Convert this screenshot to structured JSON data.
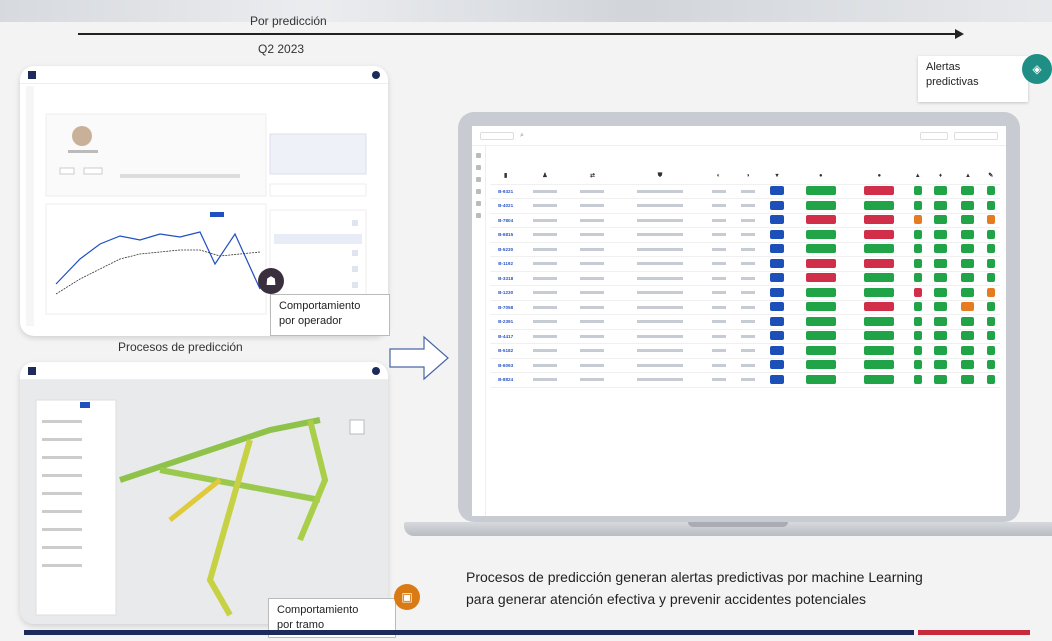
{
  "timeline": {
    "label_top": "Por predicción",
    "label_bottom": "Q2 2023"
  },
  "alerts_callout": {
    "line1": "Alertas",
    "line2": "predictivas"
  },
  "operator_callout": {
    "line1": "Comportamiento",
    "line2": "por operador"
  },
  "tramo_callout": {
    "line1": "Comportamiento",
    "line2": "por tramo"
  },
  "processes_caption": "Procesos de predicción",
  "bottom_text": {
    "line1": "Procesos de predicción generan alertas predictivas por machine Learning",
    "line2": "para generar atención efectiva y prevenir accidentes potenciales"
  },
  "colors": {
    "teal": "#1f8f86",
    "navy": "#1c2b5a",
    "red": "#c62a3c",
    "orange": "#d97a14",
    "dark": "#3a2f3c"
  },
  "alerts_table": {
    "rows": [
      {
        "id": "B-9321",
        "p": [
          "green",
          "red"
        ],
        "flags": [
          "g",
          "g",
          "g",
          "g"
        ]
      },
      {
        "id": "B-4021",
        "p": [
          "green",
          "green"
        ],
        "flags": [
          "g",
          "g",
          "g",
          "g"
        ]
      },
      {
        "id": "B-7804",
        "p": [
          "red",
          "red"
        ],
        "flags": [
          "o",
          "g",
          "g",
          "o"
        ]
      },
      {
        "id": "B-6815",
        "p": [
          "green",
          "red"
        ],
        "flags": [
          "g",
          "g",
          "g",
          "g"
        ]
      },
      {
        "id": "B-5230",
        "p": [
          "green",
          "green"
        ],
        "flags": [
          "g",
          "g",
          "g",
          "g"
        ]
      },
      {
        "id": "B-1192",
        "p": [
          "red",
          "red"
        ],
        "flags": [
          "g",
          "g",
          "g",
          "g"
        ]
      },
      {
        "id": "B-3318",
        "p": [
          "red",
          "green"
        ],
        "flags": [
          "g",
          "g",
          "g",
          "g"
        ]
      },
      {
        "id": "B-1230",
        "p": [
          "green",
          "green"
        ],
        "flags": [
          "r",
          "g",
          "g",
          "o"
        ]
      },
      {
        "id": "B-7058",
        "p": [
          "green",
          "red"
        ],
        "flags": [
          "g",
          "g",
          "o",
          "g"
        ]
      },
      {
        "id": "B-2391",
        "p": [
          "green",
          "green"
        ],
        "flags": [
          "g",
          "g",
          "g",
          "g"
        ]
      },
      {
        "id": "B-4417",
        "p": [
          "green",
          "green"
        ],
        "flags": [
          "g",
          "g",
          "g",
          "g"
        ]
      },
      {
        "id": "B-5182",
        "p": [
          "green",
          "green"
        ],
        "flags": [
          "g",
          "g",
          "g",
          "g"
        ]
      },
      {
        "id": "B-6093",
        "p": [
          "green",
          "green"
        ],
        "flags": [
          "g",
          "g",
          "g",
          "g"
        ]
      },
      {
        "id": "B-8824",
        "p": [
          "green",
          "green"
        ],
        "flags": [
          "g",
          "g",
          "g",
          "g"
        ]
      }
    ]
  }
}
